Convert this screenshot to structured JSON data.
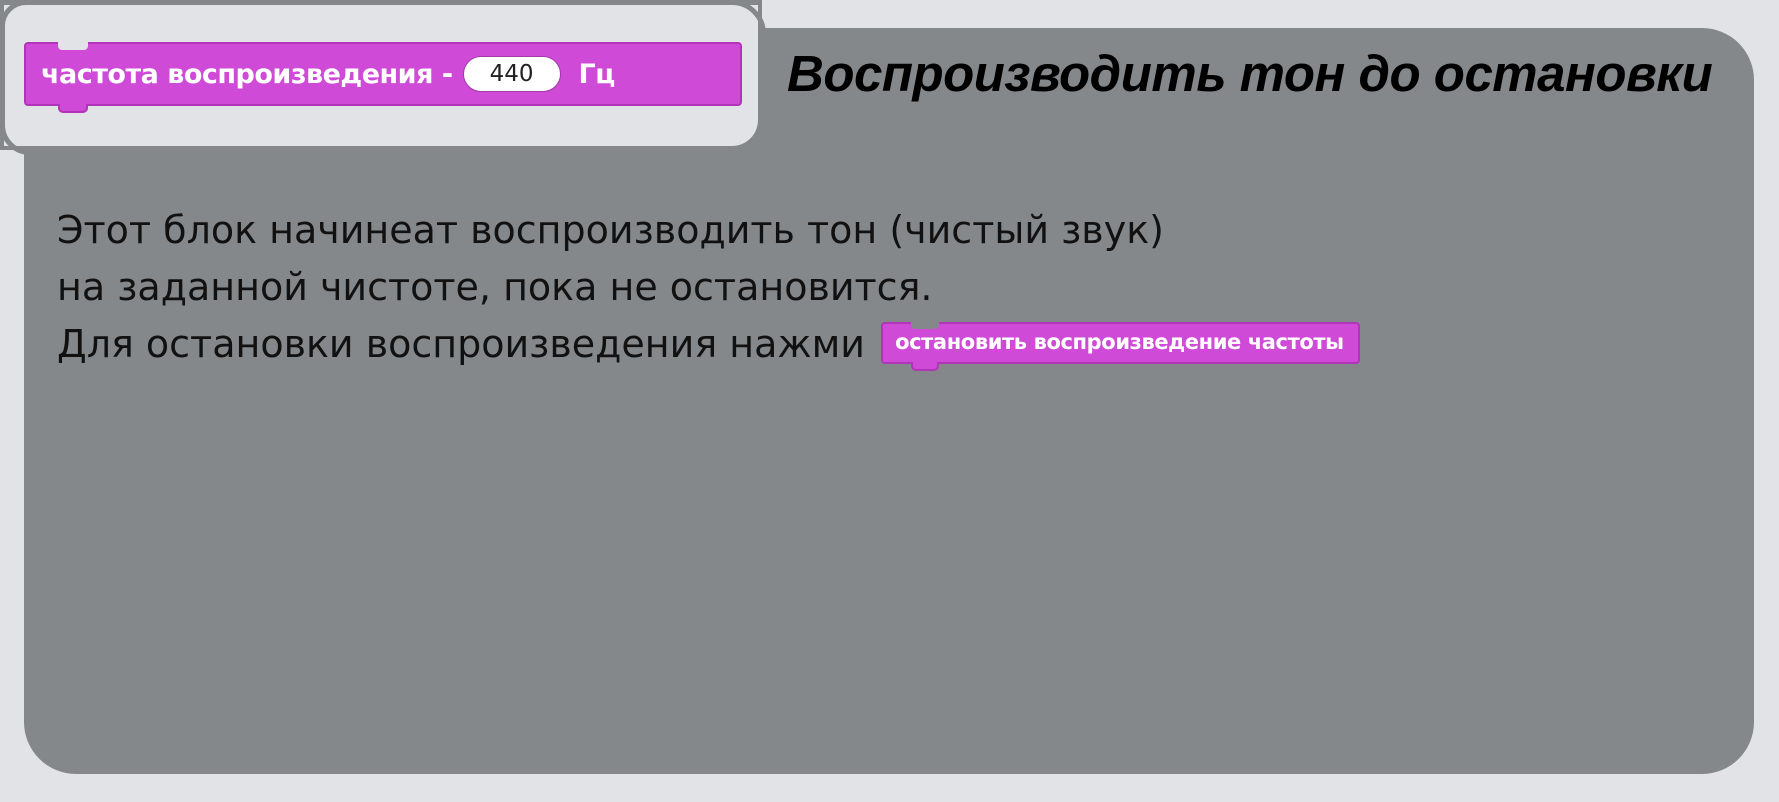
{
  "title": "Воспроизводить тон до остановки",
  "block": {
    "label_before": "частота воспроизведения -",
    "value": "440",
    "unit": "Гц"
  },
  "description": {
    "line1": "Этот блок начинеат воспроизводить тон (чистый звук)",
    "line2": "на заданной чистоте, пока не остановится.",
    "line3_prefix": "Для остановки воспроизведения нажми",
    "stop_block_label": "остановить воспроизведение частоты"
  },
  "colors": {
    "page_background": "#e2e3e7",
    "card_background": "#85888b",
    "block_fill": "#cf4ad6",
    "block_border": "#b234b8"
  }
}
